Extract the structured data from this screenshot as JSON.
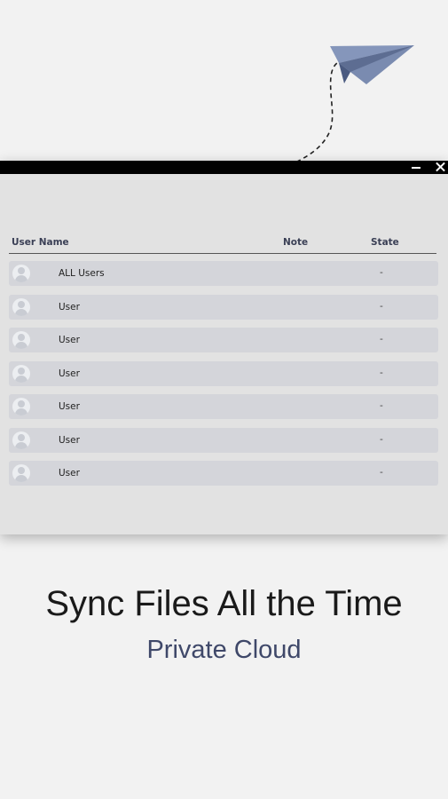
{
  "window": {
    "minimize_icon": "minimize-icon",
    "close_icon": "close-icon"
  },
  "table": {
    "headers": {
      "user_name": "User Name",
      "note": "Note",
      "state": "State"
    },
    "rows": [
      {
        "name": "ALL Users",
        "note": "",
        "state": "-"
      },
      {
        "name": "User",
        "note": "",
        "state": "-"
      },
      {
        "name": "User",
        "note": "",
        "state": "-"
      },
      {
        "name": "User",
        "note": "",
        "state": "-"
      },
      {
        "name": "User",
        "note": "",
        "state": "-"
      },
      {
        "name": "User",
        "note": "",
        "state": "-"
      },
      {
        "name": "User",
        "note": "",
        "state": "-"
      }
    ]
  },
  "promo": {
    "headline": "Sync Files All the Time",
    "subline": "Private Cloud"
  },
  "colors": {
    "background": "#f2f2f2",
    "titlebar": "#000000",
    "row": "#d4d5da",
    "plane": "#7f8fb3",
    "subline": "#3f4869"
  }
}
